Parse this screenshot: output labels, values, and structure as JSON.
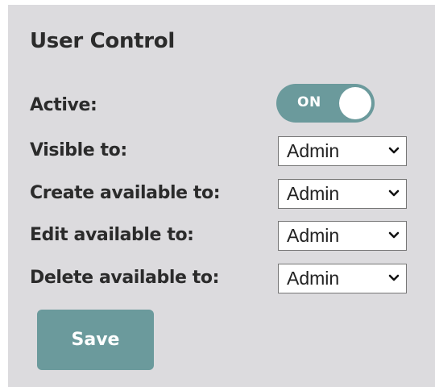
{
  "panel": {
    "title": "User Control"
  },
  "active": {
    "label": "Active:",
    "toggle_text": "ON",
    "state": "on"
  },
  "visible_to": {
    "label": "Visible to:",
    "value": "Admin"
  },
  "create_available_to": {
    "label": "Create available to:",
    "value": "Admin"
  },
  "edit_available_to": {
    "label": "Edit available to:",
    "value": "Admin"
  },
  "delete_available_to": {
    "label": "Delete available to:",
    "value": "Admin"
  },
  "save_label": "Save",
  "colors": {
    "panel_background": "#dcdbde",
    "accent": "#6b9a9c",
    "text": "#2b2b2b"
  }
}
